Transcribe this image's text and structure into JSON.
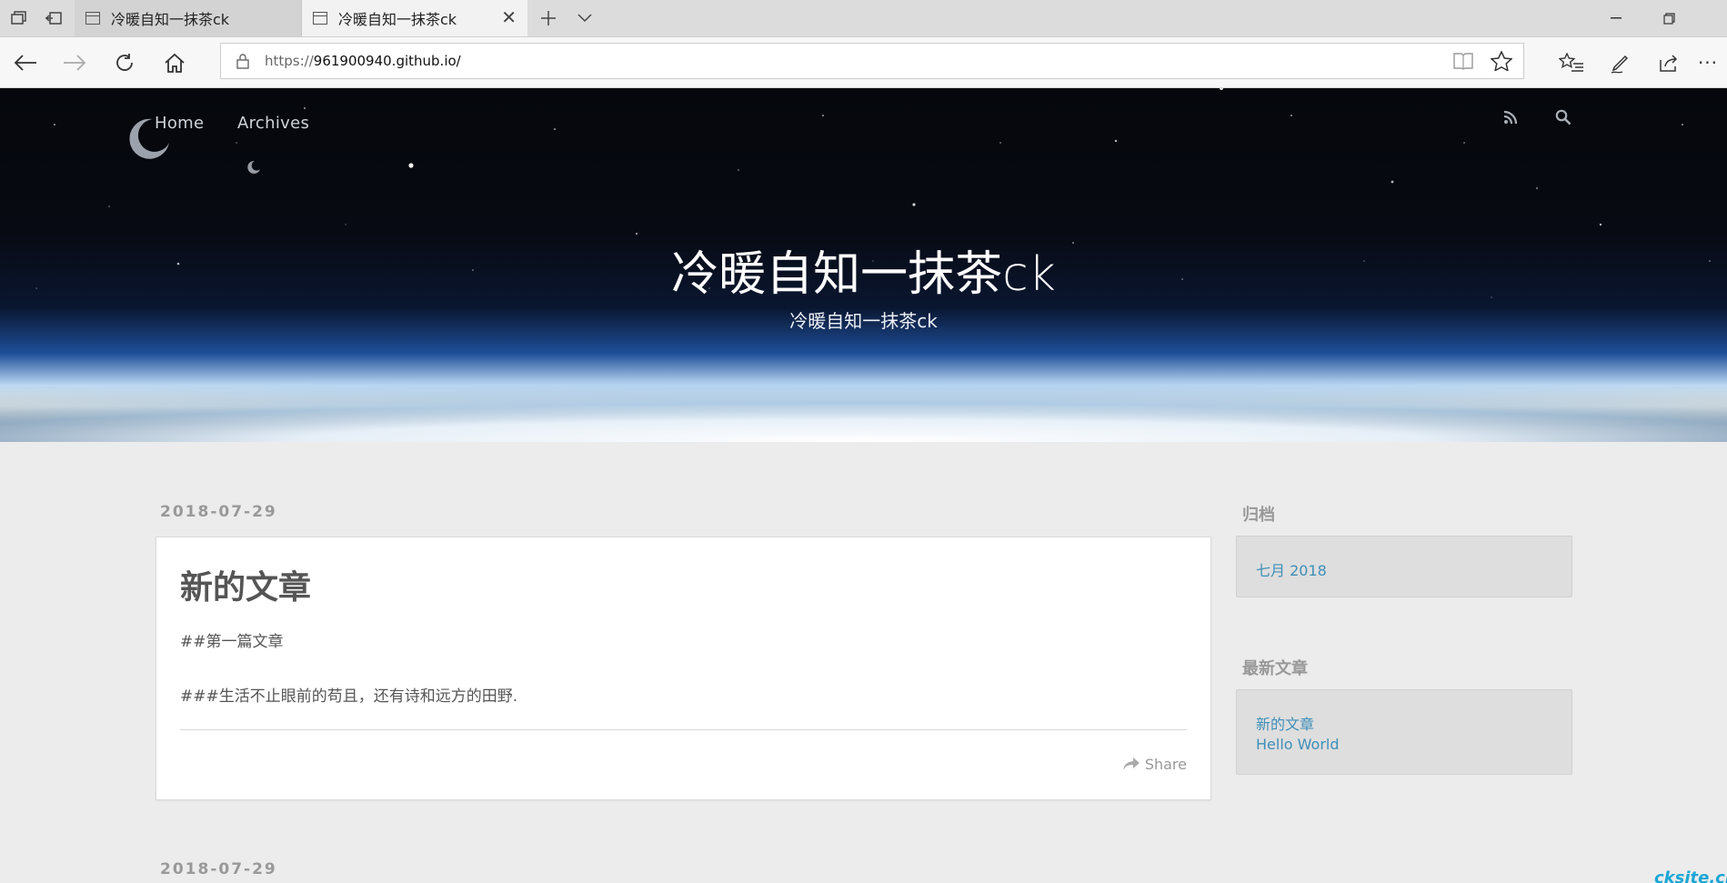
{
  "browser": {
    "tabs": [
      {
        "title": "冷暖自知一抹茶ck",
        "active": false
      },
      {
        "title": "冷暖自知一抹茶ck",
        "active": true
      }
    ],
    "url_prefix": "https://",
    "url_host": "961900940.github.io/"
  },
  "site": {
    "nav": [
      "Home",
      "Archives"
    ],
    "title": "冷暖自知一抹茶ck",
    "subtitle": "冷暖自知一抹茶ck"
  },
  "posts": [
    {
      "date": "2018-07-29",
      "title": "新的文章",
      "paragraphs": [
        "##第一篇文章",
        "###生活不止眼前的苟且，还有诗和远方的田野."
      ],
      "share_label": "Share"
    },
    {
      "date": "2018-07-29"
    }
  ],
  "sidebar": {
    "archive_heading": "归档",
    "archive_items": [
      "七月 2018"
    ],
    "recent_heading": "最新文章",
    "recent_items": [
      "新的文章",
      "Hello World"
    ]
  },
  "watermark": "cksite.cn",
  "colors": {
    "link": "#3f8fb8",
    "page_bg": "#ececec"
  }
}
